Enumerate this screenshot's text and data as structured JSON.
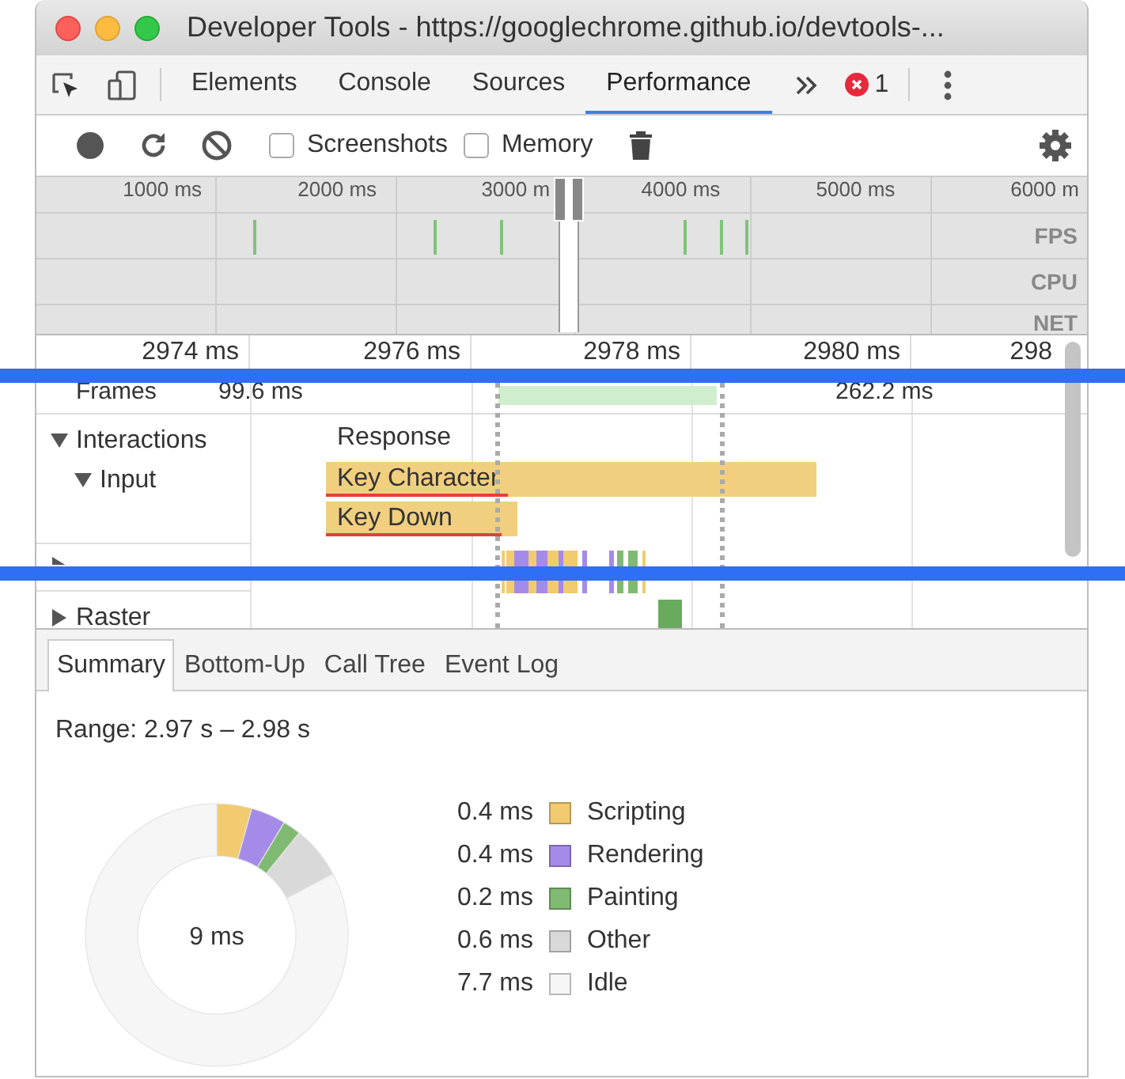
{
  "window": {
    "title": "Developer Tools - https://googlechrome.github.io/devtools-..."
  },
  "tabs": [
    {
      "label": "Elements",
      "selected": false
    },
    {
      "label": "Console",
      "selected": false
    },
    {
      "label": "Sources",
      "selected": false
    },
    {
      "label": "Performance",
      "selected": true
    }
  ],
  "error_count": "1",
  "recording_options": [
    {
      "label": "Screenshots",
      "checked": false
    },
    {
      "label": "Memory",
      "checked": false
    }
  ],
  "overview": {
    "time_labels": [
      "1000 ms",
      "2000 ms",
      "3000 m",
      "4000 ms",
      "5000 ms",
      "6000 m"
    ],
    "lanes": [
      "FPS",
      "CPU",
      "NET"
    ]
  },
  "ruler": [
    "2974 ms",
    "2976 ms",
    "2978 ms",
    "2980 ms",
    "298"
  ],
  "frames": {
    "label": "Frames",
    "durations": [
      {
        "text": "99.6 ms",
        "selected": false
      },
      {
        "selected": true
      },
      {
        "text": "262.2 ms",
        "selected": false
      }
    ]
  },
  "tracks": [
    {
      "label": "Interactions",
      "expanded": true,
      "children": [
        {
          "label": "Input",
          "expanded": true
        }
      ]
    },
    {
      "expanded": false
    },
    {
      "label": "Raster",
      "expanded": false
    }
  ],
  "events": [
    {
      "label": "Response",
      "kind": "response"
    },
    {
      "label": "Key Character",
      "kind": "input"
    },
    {
      "label": "Key Down",
      "kind": "input"
    }
  ],
  "overlay_lines": [
    {
      "kind": "highlight"
    },
    {
      "kind": "highlight"
    }
  ],
  "details": {
    "tabs": [
      {
        "label": "Summary",
        "selected": true
      },
      {
        "label": "Bottom-Up",
        "selected": false
      },
      {
        "label": "Call Tree",
        "selected": false
      },
      {
        "label": "Event Log",
        "selected": false
      }
    ],
    "range": "Range: 2.97 s – 2.98 s",
    "total": "9 ms",
    "legend": [
      {
        "value": "0.4 ms",
        "label": "Scripting",
        "color": "#f2cb70"
      },
      {
        "value": "0.4 ms",
        "label": "Rendering",
        "color": "#a58be8"
      },
      {
        "value": "0.2 ms",
        "label": "Painting",
        "color": "#80ba72"
      },
      {
        "value": "0.6 ms",
        "label": "Other",
        "color": "#d9d9d9"
      },
      {
        "value": "7.7 ms",
        "label": "Idle",
        "color": "#f6f6f6"
      }
    ],
    "chart_data": {
      "type": "donut",
      "values": [
        4.3,
        4.3,
        2.2,
        6.5,
        82.7
      ]
    }
  }
}
